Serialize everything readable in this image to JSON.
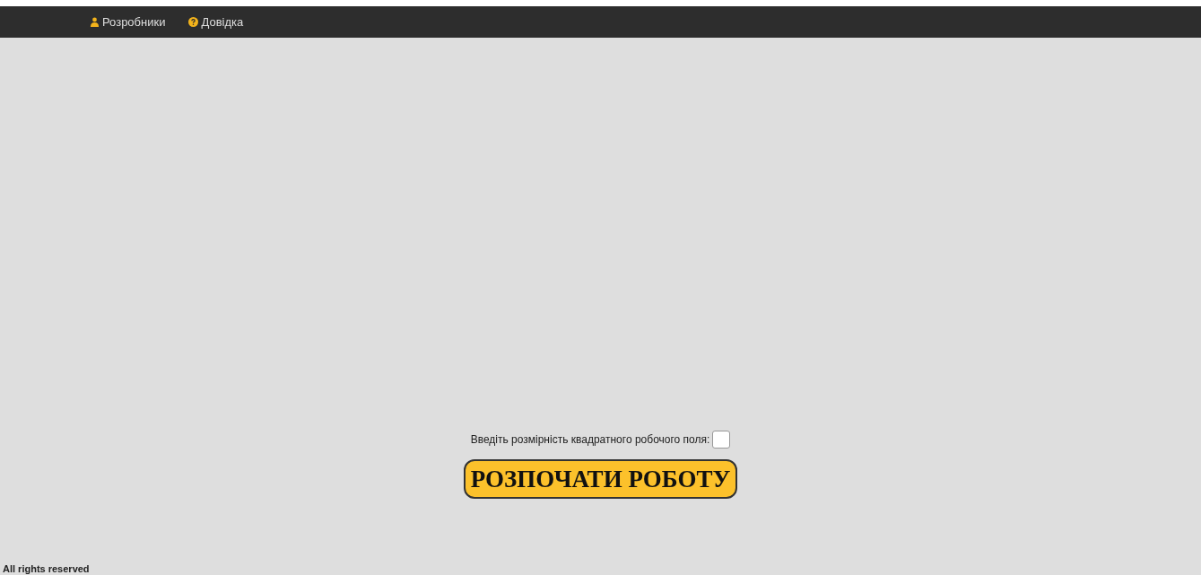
{
  "nav": [
    {
      "kind": "user",
      "label": "Розробники"
    },
    {
      "kind": "help",
      "label": "Довідка"
    }
  ],
  "size_field": {
    "label": "Введіть розмірність квадратного робочого поля:"
  },
  "start_button": "РОЗПОЧАТИ РОБОТУ",
  "footer": "All rights reserved"
}
